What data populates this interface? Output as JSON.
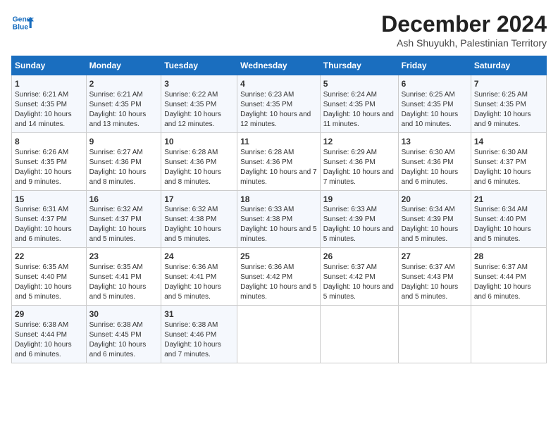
{
  "header": {
    "logo_line1": "General",
    "logo_line2": "Blue",
    "title": "December 2024",
    "subtitle": "Ash Shuyukh, Palestinian Territory"
  },
  "days_of_week": [
    "Sunday",
    "Monday",
    "Tuesday",
    "Wednesday",
    "Thursday",
    "Friday",
    "Saturday"
  ],
  "weeks": [
    [
      {
        "day": "1",
        "sunrise": "6:21 AM",
        "sunset": "4:35 PM",
        "daylight": "10 hours and 14 minutes."
      },
      {
        "day": "2",
        "sunrise": "6:21 AM",
        "sunset": "4:35 PM",
        "daylight": "10 hours and 13 minutes."
      },
      {
        "day": "3",
        "sunrise": "6:22 AM",
        "sunset": "4:35 PM",
        "daylight": "10 hours and 12 minutes."
      },
      {
        "day": "4",
        "sunrise": "6:23 AM",
        "sunset": "4:35 PM",
        "daylight": "10 hours and 12 minutes."
      },
      {
        "day": "5",
        "sunrise": "6:24 AM",
        "sunset": "4:35 PM",
        "daylight": "10 hours and 11 minutes."
      },
      {
        "day": "6",
        "sunrise": "6:25 AM",
        "sunset": "4:35 PM",
        "daylight": "10 hours and 10 minutes."
      },
      {
        "day": "7",
        "sunrise": "6:25 AM",
        "sunset": "4:35 PM",
        "daylight": "10 hours and 9 minutes."
      }
    ],
    [
      {
        "day": "8",
        "sunrise": "6:26 AM",
        "sunset": "4:35 PM",
        "daylight": "10 hours and 9 minutes."
      },
      {
        "day": "9",
        "sunrise": "6:27 AM",
        "sunset": "4:36 PM",
        "daylight": "10 hours and 8 minutes."
      },
      {
        "day": "10",
        "sunrise": "6:28 AM",
        "sunset": "4:36 PM",
        "daylight": "10 hours and 8 minutes."
      },
      {
        "day": "11",
        "sunrise": "6:28 AM",
        "sunset": "4:36 PM",
        "daylight": "10 hours and 7 minutes."
      },
      {
        "day": "12",
        "sunrise": "6:29 AM",
        "sunset": "4:36 PM",
        "daylight": "10 hours and 7 minutes."
      },
      {
        "day": "13",
        "sunrise": "6:30 AM",
        "sunset": "4:36 PM",
        "daylight": "10 hours and 6 minutes."
      },
      {
        "day": "14",
        "sunrise": "6:30 AM",
        "sunset": "4:37 PM",
        "daylight": "10 hours and 6 minutes."
      }
    ],
    [
      {
        "day": "15",
        "sunrise": "6:31 AM",
        "sunset": "4:37 PM",
        "daylight": "10 hours and 6 minutes."
      },
      {
        "day": "16",
        "sunrise": "6:32 AM",
        "sunset": "4:37 PM",
        "daylight": "10 hours and 5 minutes."
      },
      {
        "day": "17",
        "sunrise": "6:32 AM",
        "sunset": "4:38 PM",
        "daylight": "10 hours and 5 minutes."
      },
      {
        "day": "18",
        "sunrise": "6:33 AM",
        "sunset": "4:38 PM",
        "daylight": "10 hours and 5 minutes."
      },
      {
        "day": "19",
        "sunrise": "6:33 AM",
        "sunset": "4:39 PM",
        "daylight": "10 hours and 5 minutes."
      },
      {
        "day": "20",
        "sunrise": "6:34 AM",
        "sunset": "4:39 PM",
        "daylight": "10 hours and 5 minutes."
      },
      {
        "day": "21",
        "sunrise": "6:34 AM",
        "sunset": "4:40 PM",
        "daylight": "10 hours and 5 minutes."
      }
    ],
    [
      {
        "day": "22",
        "sunrise": "6:35 AM",
        "sunset": "4:40 PM",
        "daylight": "10 hours and 5 minutes."
      },
      {
        "day": "23",
        "sunrise": "6:35 AM",
        "sunset": "4:41 PM",
        "daylight": "10 hours and 5 minutes."
      },
      {
        "day": "24",
        "sunrise": "6:36 AM",
        "sunset": "4:41 PM",
        "daylight": "10 hours and 5 minutes."
      },
      {
        "day": "25",
        "sunrise": "6:36 AM",
        "sunset": "4:42 PM",
        "daylight": "10 hours and 5 minutes."
      },
      {
        "day": "26",
        "sunrise": "6:37 AM",
        "sunset": "4:42 PM",
        "daylight": "10 hours and 5 minutes."
      },
      {
        "day": "27",
        "sunrise": "6:37 AM",
        "sunset": "4:43 PM",
        "daylight": "10 hours and 5 minutes."
      },
      {
        "day": "28",
        "sunrise": "6:37 AM",
        "sunset": "4:44 PM",
        "daylight": "10 hours and 6 minutes."
      }
    ],
    [
      {
        "day": "29",
        "sunrise": "6:38 AM",
        "sunset": "4:44 PM",
        "daylight": "10 hours and 6 minutes."
      },
      {
        "day": "30",
        "sunrise": "6:38 AM",
        "sunset": "4:45 PM",
        "daylight": "10 hours and 6 minutes."
      },
      {
        "day": "31",
        "sunrise": "6:38 AM",
        "sunset": "4:46 PM",
        "daylight": "10 hours and 7 minutes."
      },
      null,
      null,
      null,
      null
    ]
  ]
}
